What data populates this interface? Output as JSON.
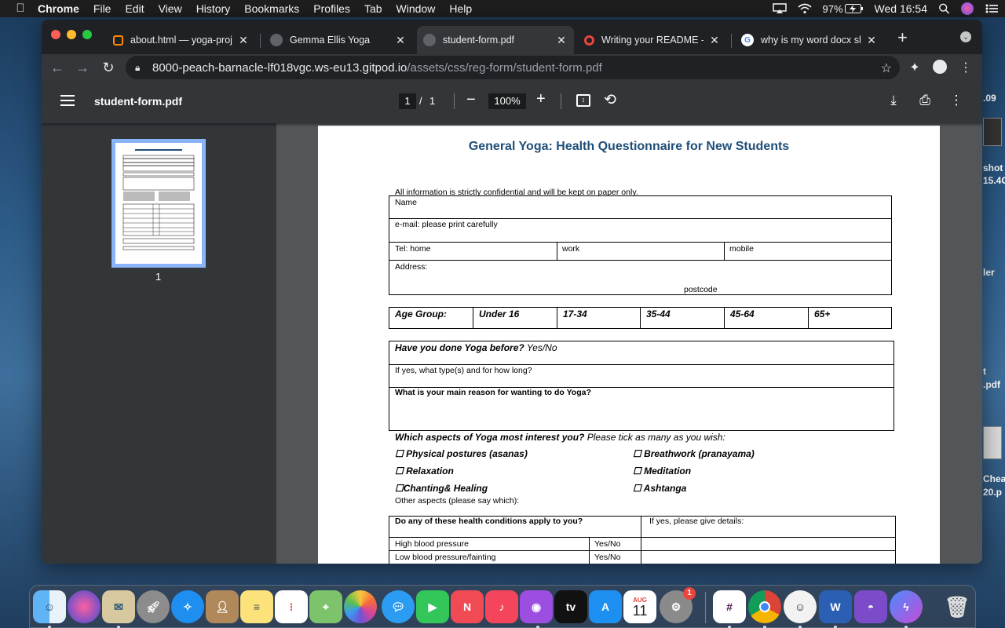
{
  "menubar": {
    "app": "Chrome",
    "menus": [
      "File",
      "Edit",
      "View",
      "History",
      "Bookmarks",
      "Profiles",
      "Tab",
      "Window",
      "Help"
    ],
    "battery": "97%",
    "clock": "Wed 16:54"
  },
  "desktop": {
    "items": [
      ".09",
      "shot",
      "15.4C",
      "ler",
      "t",
      ".pdf",
      "Chea",
      "20.p"
    ]
  },
  "tabs": [
    {
      "label": "about.html — yoga-proj",
      "favicon": "gitpod-icon",
      "color": "#ff8a00"
    },
    {
      "label": "Gemma Ellis Yoga",
      "favicon": "globe-icon",
      "color": "#5f6368"
    },
    {
      "label": "student-form.pdf",
      "favicon": "globe-icon",
      "color": "#5f6368",
      "active": true
    },
    {
      "label": "Writing your README - ",
      "favicon": "record-icon",
      "color": "#e8453c"
    },
    {
      "label": "why is my word docx sh",
      "favicon": "google-icon",
      "color": "#4285f4"
    }
  ],
  "address": {
    "host": "8000-peach-barnacle-lf018vgc.ws-eu13.gitpod.io",
    "path": "/assets/css/reg-form/student-form.pdf"
  },
  "pdf": {
    "title": "student-form.pdf",
    "page": "1",
    "page_sep": "/",
    "total": "1",
    "zoom": "100%",
    "thumb_label": "1"
  },
  "form": {
    "heading": "General Yoga: Health Questionnaire for New Students",
    "confidential": "All information is strictly confidential and will be kept on paper only.",
    "name": "Name",
    "email": "e-mail: please print carefully",
    "tel_home": "Tel: home",
    "tel_work": "work",
    "tel_mobile": "mobile",
    "address": "Address:",
    "postcode": "postcode",
    "age_label": "Age Group:",
    "age_groups": [
      "Under 16",
      "17-34",
      "35-44",
      "45-64",
      "65+"
    ],
    "yoga_before_q": "Have you done Yoga before?",
    "yoga_before_a": " Yes/No",
    "yoga_types": "If yes, what type(s) and for how long?",
    "main_reason": "What is your main reason for wanting to do Yoga?",
    "aspects_q": "Which aspects of Yoga most interest you?",
    "aspects_hint": " Please tick as many as you wish:",
    "aspects_left": [
      "☐ Physical postures (asanas)",
      "☐ Relaxation",
      "☐Chanting& Healing"
    ],
    "aspects_right": [
      "☐ Breathwork (pranayama)",
      "☐  Meditation",
      "☐ Ashtanga"
    ],
    "other_aspects": "Other aspects (please say which):",
    "health_q": "Do any of these health conditions apply to you?",
    "health_details": "If yes, please give details:",
    "conditions": [
      {
        "name": "High blood pressure",
        "answer": "Yes/No"
      },
      {
        "name": "Low blood pressure/fainting",
        "answer": "Yes/No"
      }
    ]
  },
  "dock": {
    "calendar_month": "AUG",
    "calendar_day": "11",
    "settings_badge": "1",
    "tv_label": "tv",
    "word_label": "W"
  }
}
